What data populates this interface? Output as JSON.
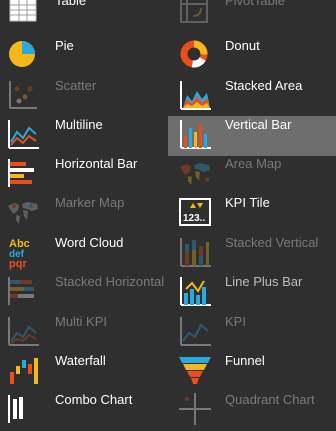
{
  "items": [
    {
      "label": "Table",
      "icon": "table-icon",
      "enabled": true,
      "selected": false
    },
    {
      "label": "PivotTable",
      "icon": "pivot-table-icon",
      "enabled": false,
      "selected": false
    },
    {
      "label": "Pie",
      "icon": "pie-chart-icon",
      "enabled": true,
      "selected": false
    },
    {
      "label": "Donut",
      "icon": "donut-chart-icon",
      "enabled": true,
      "selected": false
    },
    {
      "label": "Scatter",
      "icon": "scatter-chart-icon",
      "enabled": false,
      "selected": false
    },
    {
      "label": "Stacked Area",
      "icon": "stacked-area-icon",
      "enabled": true,
      "selected": false
    },
    {
      "label": "Multiline",
      "icon": "multiline-chart-icon",
      "enabled": true,
      "selected": false
    },
    {
      "label": "Vertical Bar",
      "icon": "vertical-bar-icon",
      "enabled": true,
      "selected": true
    },
    {
      "label": "Horizontal Bar",
      "icon": "horizontal-bar-icon",
      "enabled": true,
      "selected": false
    },
    {
      "label": "Area Map",
      "icon": "area-map-icon",
      "enabled": false,
      "selected": false
    },
    {
      "label": "Marker Map",
      "icon": "marker-map-icon",
      "enabled": false,
      "selected": false
    },
    {
      "label": "KPI Tile",
      "icon": "kpi-tile-icon",
      "enabled": true,
      "selected": false
    },
    {
      "label": "Word Cloud",
      "icon": "word-cloud-icon",
      "enabled": true,
      "selected": false
    },
    {
      "label": "Stacked Vertical",
      "icon": "stacked-vertical-icon",
      "enabled": false,
      "selected": false
    },
    {
      "label": "Stacked Horizontal",
      "icon": "stacked-horizontal-icon",
      "enabled": false,
      "selected": false
    },
    {
      "label": "Line Plus Bar",
      "icon": "line-plus-bar-icon",
      "enabled": false,
      "selected": false
    },
    {
      "label": "Multi KPI",
      "icon": "multi-kpi-icon",
      "enabled": false,
      "selected": false
    },
    {
      "label": "KPI",
      "icon": "kpi-icon",
      "enabled": false,
      "selected": false
    },
    {
      "label": "Waterfall",
      "icon": "waterfall-icon",
      "enabled": true,
      "selected": false
    },
    {
      "label": "Funnel",
      "icon": "funnel-icon",
      "enabled": true,
      "selected": false
    },
    {
      "label": "Combo Chart",
      "icon": "combo-chart-icon",
      "enabled": true,
      "selected": false
    },
    {
      "label": "Quadrant Chart",
      "icon": "quadrant-chart-icon",
      "enabled": false,
      "selected": false
    }
  ],
  "word_cloud_glyph": {
    "line1": "Abc",
    "line2": "def",
    "line3": "pqr"
  },
  "kpi_tile_glyph": "123..",
  "colors": {
    "background": "#2f2f2f",
    "selected": "#6e6e6e",
    "label": "#ffffff",
    "disabled_label": "#7a7a7a"
  }
}
